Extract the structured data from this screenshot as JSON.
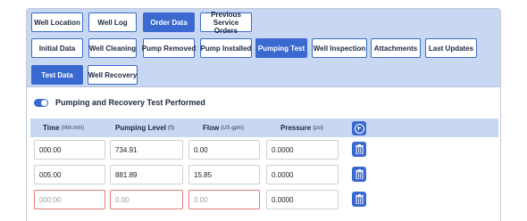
{
  "nav": {
    "row1": [
      {
        "label": "Well Location",
        "active": false
      },
      {
        "label": "Well Log",
        "active": false
      },
      {
        "label": "Order Data",
        "active": true
      },
      {
        "label": "Previous Service Orders",
        "active": false
      }
    ],
    "row2": [
      {
        "label": "Initial Data",
        "active": false
      },
      {
        "label": "Well Cleaning",
        "active": false
      },
      {
        "label": "Pump Removed",
        "active": false
      },
      {
        "label": "Pump Installed",
        "active": false
      },
      {
        "label": "Pumping Test",
        "active": true
      },
      {
        "label": "Well Inspection",
        "active": false
      },
      {
        "label": "Attachments",
        "active": false
      },
      {
        "label": "Last Updates",
        "active": false
      }
    ],
    "row3": [
      {
        "label": "Test Data",
        "active": true
      },
      {
        "label": "Well Recovery",
        "active": false
      }
    ]
  },
  "toggle": {
    "label": "Pumping and Recovery Test Performed",
    "on": true
  },
  "table": {
    "headers": [
      {
        "label": "Time",
        "unit": "(hhh:mm)"
      },
      {
        "label": "Pumping Level",
        "unit": "(ft)"
      },
      {
        "label": "Flow",
        "unit": "(US gpm)"
      },
      {
        "label": "Pressure",
        "unit": "(psi)"
      }
    ],
    "rows": [
      {
        "time": "000:00",
        "level": "734.91",
        "flow": "0.00",
        "pressure": "0.0000"
      },
      {
        "time": "005:00",
        "level": "881.89",
        "flow": "15.85",
        "pressure": "0.0000"
      }
    ],
    "new_row": {
      "time": "000:00",
      "level": "0.00",
      "flow": "0.00",
      "pressure": "0.0000"
    }
  },
  "icons": {
    "add": "plus-circle-icon",
    "delete": "trash-icon"
  },
  "colors": {
    "accent": "#3a69cf",
    "panel": "#c9d8f2",
    "error": "#e07b7b"
  }
}
